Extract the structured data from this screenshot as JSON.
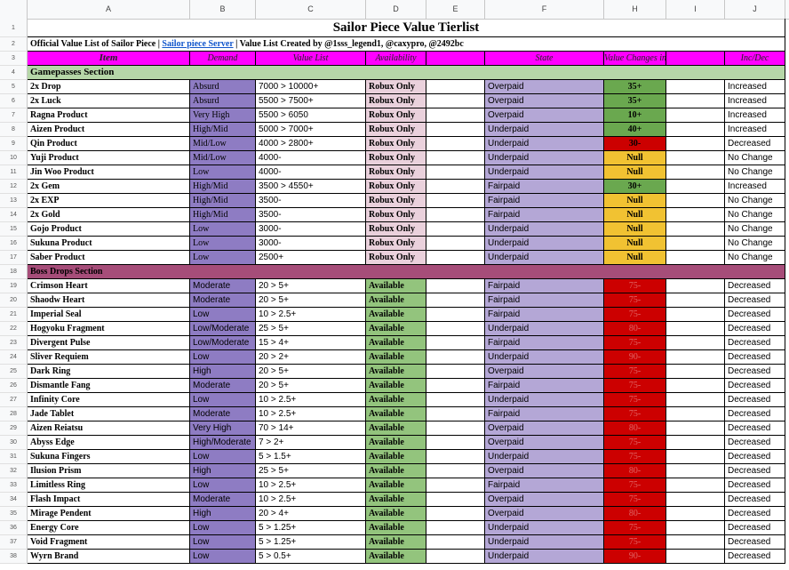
{
  "columns": [
    "A",
    "B",
    "C",
    "D",
    "E",
    "F",
    "H",
    "I",
    "J"
  ],
  "title": "Sailor Piece Value Tierlist",
  "subtitle": {
    "prefix": "Official Value List of Sailor Piece | ",
    "link": "Sailor piece Server",
    "suffix": " | Value List Created by @1sss_legend1, @caxypro, @2492bc"
  },
  "headers": {
    "item": "Item",
    "demand": "Demand",
    "value": "Value List",
    "availability": "Availability",
    "e": "",
    "state": "State",
    "change": "Value Changes in %",
    "i": "",
    "incdec": "Inc/Dec"
  },
  "sections": {
    "gamepasses": "Gamepasses Section",
    "boss": "Boss Drops Section"
  },
  "colors": {
    "magenta": "#ff00ff",
    "section_green": "#b6d7a8",
    "section_maroon": "#a64d79",
    "demand_purple": "#8e7cc3",
    "robux_pink": "#ead1dc",
    "available_green": "#93c47d",
    "state_lavender": "#b4a7d6",
    "change_green": "#6aa84f",
    "change_red": "#cc0000",
    "change_yellow": "#f1c232"
  },
  "gamepasses": [
    {
      "row": "5",
      "item": "2x Drop",
      "demand": "Absurd",
      "value": "7000 > 10000+",
      "avail": "Robux Only",
      "state": "Overpaid",
      "change": "35+",
      "change_color": "green",
      "dir": "Increased"
    },
    {
      "row": "6",
      "item": "2x Luck",
      "demand": "Absurd",
      "value": "5500 > 7500+",
      "avail": "Robux Only",
      "state": "Overpaid",
      "change": "35+",
      "change_color": "green",
      "dir": "Increased"
    },
    {
      "row": "7",
      "item": "Ragna Product",
      "demand": "Very High",
      "value": "5500 > 6050",
      "avail": "Robux Only",
      "state": "Overpaid",
      "change": "10+",
      "change_color": "green",
      "dir": "Increased"
    },
    {
      "row": "8",
      "item": "Aizen Product",
      "demand": "High/Mid",
      "value": "5000 > 7000+",
      "avail": "Robux Only",
      "state": "Underpaid",
      "change": "40+",
      "change_color": "green",
      "dir": "Increased"
    },
    {
      "row": "9",
      "item": "Qin Product",
      "demand": "Mid/Low",
      "value": "4000 > 2800+",
      "avail": "Robux Only",
      "state": "Underpaid",
      "change": "30-",
      "change_color": "red",
      "dir": "Decreased"
    },
    {
      "row": "10",
      "item": "Yuji Product",
      "demand": "Mid/Low",
      "value": "4000-",
      "avail": "Robux Only",
      "state": "Underpaid",
      "change": "Null",
      "change_color": "yellow",
      "dir": "No Change"
    },
    {
      "row": "11",
      "item": "Jin Woo Product",
      "demand": "Low",
      "value": "4000-",
      "avail": "Robux Only",
      "state": "Underpaid",
      "change": "Null",
      "change_color": "yellow",
      "dir": "No Change"
    },
    {
      "row": "12",
      "item": "2x Gem",
      "demand": "High/Mid",
      "value": "3500 > 4550+",
      "avail": "Robux Only",
      "state": "Fairpaid",
      "change": "30+",
      "change_color": "green",
      "dir": "Increased"
    },
    {
      "row": "13",
      "item": "2x EXP",
      "demand": "High/Mid",
      "value": "3500-",
      "avail": "Robux Only",
      "state": "Fairpaid",
      "change": "Null",
      "change_color": "yellow",
      "dir": "No Change"
    },
    {
      "row": "14",
      "item": "2x Gold",
      "demand": "High/Mid",
      "value": "3500-",
      "avail": "Robux Only",
      "state": "Fairpaid",
      "change": "Null",
      "change_color": "yellow",
      "dir": "No Change"
    },
    {
      "row": "15",
      "item": "Gojo Product",
      "demand": "Low",
      "value": "3000-",
      "avail": "Robux Only",
      "state": "Underpaid",
      "change": "Null",
      "change_color": "yellow",
      "dir": "No Change"
    },
    {
      "row": "16",
      "item": "Sukuna Product",
      "demand": "Low",
      "value": "3000-",
      "avail": "Robux Only",
      "state": "Underpaid",
      "change": "Null",
      "change_color": "yellow",
      "dir": "No Change"
    },
    {
      "row": "17",
      "item": "Saber Product",
      "demand": "Low",
      "value": "2500+",
      "avail": "Robux Only",
      "state": "Underpaid",
      "change": "Null",
      "change_color": "yellow",
      "dir": "No Change"
    }
  ],
  "boss": [
    {
      "row": "19",
      "item": "Crimson Heart",
      "demand": "Moderate",
      "value": "20 > 5+",
      "avail": "Available",
      "state": "Fairpaid",
      "change": "75-",
      "dir": "Decreased"
    },
    {
      "row": "20",
      "item": "Shaodw Heart",
      "demand": "Moderate",
      "value": "20 > 5+",
      "avail": "Available",
      "state": "Fairpaid",
      "change": "75-",
      "dir": "Decreased"
    },
    {
      "row": "21",
      "item": "Imperial Seal",
      "demand": "Low",
      "value": "10 > 2.5+",
      "avail": "Available",
      "state": "Fairpaid",
      "change": "75-",
      "dir": "Decreased"
    },
    {
      "row": "22",
      "item": "Hogyoku Fragment",
      "demand": "Low/Moderate",
      "value": "25 > 5+",
      "avail": "Available",
      "state": "Underpaid",
      "change": "80-",
      "dir": "Decreased"
    },
    {
      "row": "23",
      "item": "Divergent Pulse",
      "demand": "Low/Moderate",
      "value": "15 > 4+",
      "avail": "Available",
      "state": "Fairpaid",
      "change": "75-",
      "dir": "Decreased"
    },
    {
      "row": "24",
      "item": "Sliver Requiem",
      "demand": "Low",
      "value": "20 > 2+",
      "avail": "Available",
      "state": "Underpaid",
      "change": "90-",
      "dir": "Decreased"
    },
    {
      "row": "25",
      "item": "Dark Ring",
      "demand": "High",
      "value": "20 > 5+",
      "avail": "Available",
      "state": "Overpaid",
      "change": "75-",
      "dir": "Decreased"
    },
    {
      "row": "26",
      "item": "Dismantle Fang",
      "demand": "Moderate",
      "value": "20 > 5+",
      "avail": "Available",
      "state": "Fairpaid",
      "change": "75-",
      "dir": "Decreased"
    },
    {
      "row": "27",
      "item": "Infinity Core",
      "demand": "Low",
      "value": "10 > 2.5+",
      "avail": "Available",
      "state": "Underpaid",
      "change": "75-",
      "dir": "Decreased"
    },
    {
      "row": "28",
      "item": "Jade Tablet",
      "demand": "Moderate",
      "value": "10 > 2.5+",
      "avail": "Available",
      "state": "Fairpaid",
      "change": "75-",
      "dir": "Decreased"
    },
    {
      "row": "29",
      "item": "Aizen Reiatsu",
      "demand": "Very High",
      "value": "70 > 14+",
      "avail": "Available",
      "state": "Overpaid",
      "change": "80-",
      "dir": "Decreased"
    },
    {
      "row": "30",
      "item": "Abyss Edge",
      "demand": "High/Moderate",
      "value": "7 > 2+",
      "avail": "Available",
      "state": "Overpaid",
      "change": "75-",
      "dir": "Decreased"
    },
    {
      "row": "31",
      "item": "Sukuna Fingers",
      "demand": "Low",
      "value": "5 > 1.5+",
      "avail": "Available",
      "state": "Underpaid",
      "change": "75-",
      "dir": "Decreased"
    },
    {
      "row": "32",
      "item": "Ilusion Prism",
      "demand": "High",
      "value": "25 > 5+",
      "avail": "Available",
      "state": "Overpaid",
      "change": "80-",
      "dir": "Decreased"
    },
    {
      "row": "33",
      "item": "Limitless Ring",
      "demand": "Low",
      "value": "10 > 2.5+",
      "avail": "Available",
      "state": "Fairpaid",
      "change": "75-",
      "dir": "Decreased"
    },
    {
      "row": "34",
      "item": "Flash Impact",
      "demand": "Moderate",
      "value": "10 > 2.5+",
      "avail": "Available",
      "state": "Overpaid",
      "change": "75-",
      "dir": "Decreased"
    },
    {
      "row": "35",
      "item": "Mirage Pendent",
      "demand": "High",
      "value": "20 > 4+",
      "avail": "Available",
      "state": "Overpaid",
      "change": "80-",
      "dir": "Decreased"
    },
    {
      "row": "36",
      "item": "Energy Core",
      "demand": "Low",
      "value": "5 > 1.25+",
      "avail": "Available",
      "state": "Underpaid",
      "change": "75-",
      "dir": "Decreased"
    },
    {
      "row": "37",
      "item": "Void Fragment",
      "demand": "Low",
      "value": "5 > 1.25+",
      "avail": "Available",
      "state": "Underpaid",
      "change": "75-",
      "dir": "Decreased"
    },
    {
      "row": "38",
      "item": "Wyrn Brand",
      "demand": "Low",
      "value": "5 > 0.5+",
      "avail": "Available",
      "state": "Underpaid",
      "change": "90-",
      "dir": "Decreased"
    }
  ]
}
